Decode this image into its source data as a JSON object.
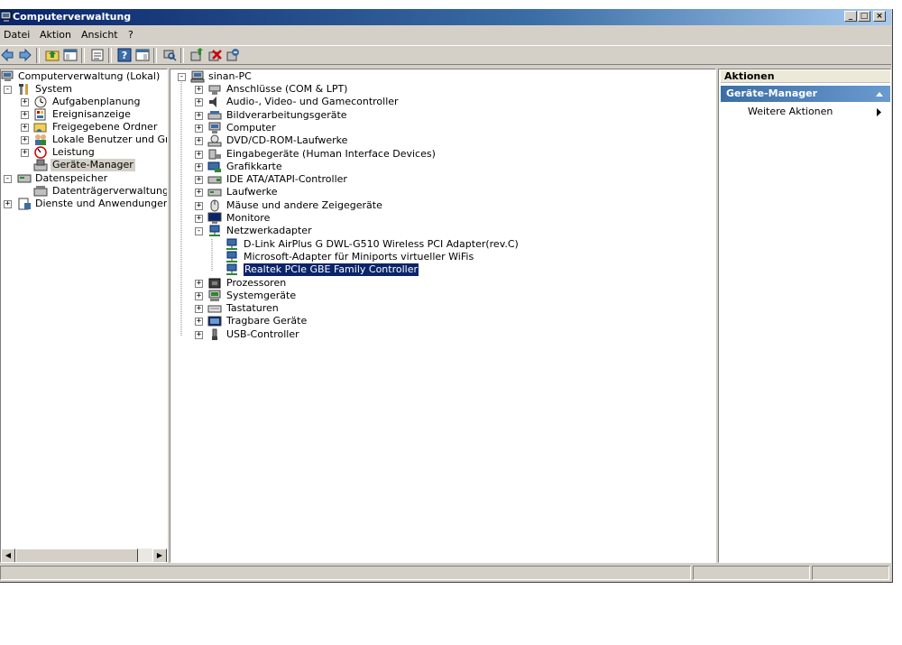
{
  "window": {
    "title": "Computerverwaltung"
  },
  "menu": [
    "Datei",
    "Aktion",
    "Ansicht",
    "?"
  ],
  "nav_tree": {
    "root": "Computerverwaltung (Lokal)",
    "system": "System",
    "system_children": [
      "Aufgabenplanung",
      "Ereignisanzeige",
      "Freigegebene Ordner",
      "Lokale Benutzer und Grupp",
      "Leistung",
      "Geräte-Manager"
    ],
    "storage": "Datenspeicher",
    "storage_children": [
      "Datenträgerverwaltung"
    ],
    "services": "Dienste und Anwendungen"
  },
  "device_tree": {
    "computer": "sinan-PC",
    "categories": [
      "Anschlüsse (COM & LPT)",
      "Audio-, Video- und Gamecontroller",
      "Bildverarbeitungsgeräte",
      "Computer",
      "DVD/CD-ROM-Laufwerke",
      "Eingabegeräte (Human Interface Devices)",
      "Grafikkarte",
      "IDE ATA/ATAPI-Controller",
      "Laufwerke",
      "Mäuse und andere Zeigegeräte",
      "Monitore",
      "Netzwerkadapter"
    ],
    "network_adapters": [
      "D-Link AirPlus G DWL-G510 Wireless PCI Adapter(rev.C)",
      "Microsoft-Adapter für Miniports virtueller WiFis",
      "Realtek PCIe GBE Family Controller"
    ],
    "categories_after": [
      "Prozessoren",
      "Systemgeräte",
      "Tastaturen",
      "Tragbare Geräte",
      "USB-Controller"
    ]
  },
  "actions": {
    "header": "Aktionen",
    "section": "Geräte-Manager",
    "item": "Weitere Aktionen"
  }
}
